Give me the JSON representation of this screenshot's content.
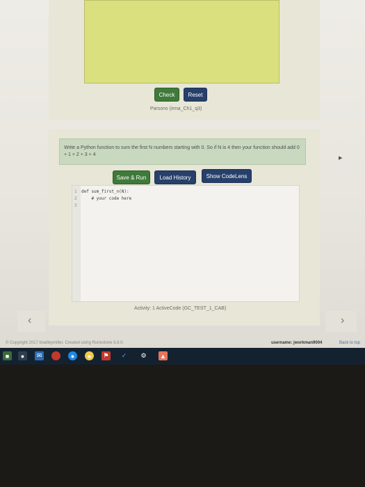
{
  "parsons": {
    "check_label": "Check",
    "reset_label": "Reset",
    "caption": "Parsons (irma_Ch1_q3)"
  },
  "activecode": {
    "prompt": "Write a Python function to sum the first N numbers starting with 0. So if N is 4 then your function should add 0 + 1 + 2 + 3 + 4",
    "save_run_label": "Save & Run",
    "load_history_label": "Load History",
    "show_codelens_label": "Show CodeLens",
    "lines": [
      {
        "num": "1",
        "code": "def sum_first_n(N):"
      },
      {
        "num": "2",
        "code": "    # your code here"
      },
      {
        "num": "3",
        "code": ""
      }
    ],
    "caption": "Activity: 1 ActiveCode (GC_TEST_1_CAB)"
  },
  "nav": {
    "prev_icon": "chevron-left-icon",
    "next_icon": "chevron-right-icon",
    "prev_glyph": "‹",
    "next_glyph": "›"
  },
  "footer": {
    "copyright": "© Copyright 2017 bradleymiller. Created using Runestone 5.6.0.",
    "username_label": "username:",
    "username": "jworkman9004",
    "back_link": "Back to top"
  },
  "colors": {
    "check_button": "#3f7a3a",
    "reset_button": "#27406b",
    "save_run_button": "#3f7a3a",
    "load_history_button": "#27406b",
    "codelens_button": "#27406b",
    "taskbar": "#142230"
  }
}
